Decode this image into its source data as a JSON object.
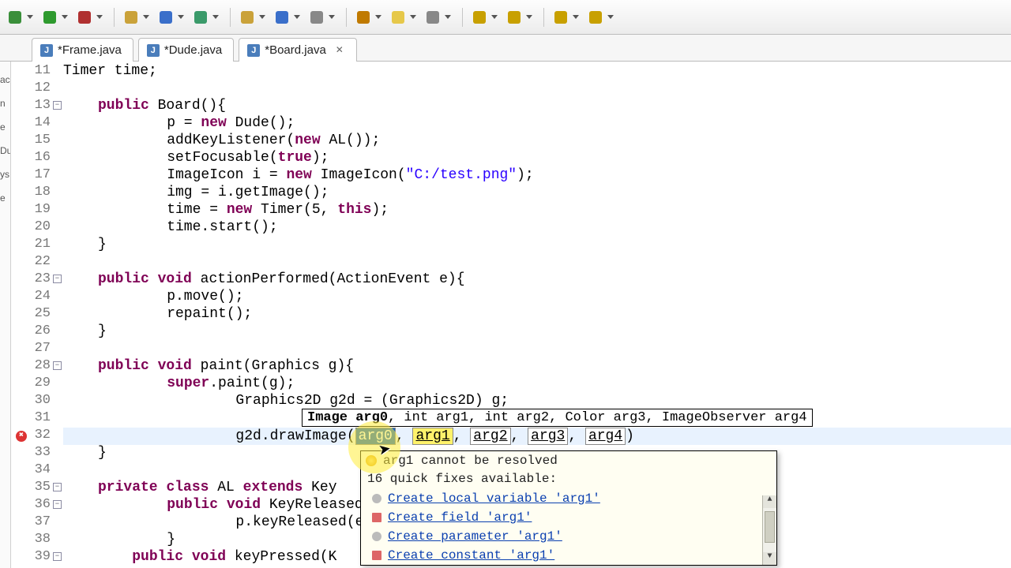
{
  "tabs": [
    {
      "label": "*Frame.java"
    },
    {
      "label": "*Dude.java"
    },
    {
      "label": "*Board.java",
      "active": true,
      "closable": true
    }
  ],
  "left_strip": [
    "ac",
    "n",
    "e",
    "Du",
    "ys",
    "e"
  ],
  "lines": [
    {
      "n": 11,
      "html": "Timer time;"
    },
    {
      "n": 12,
      "html": ""
    },
    {
      "n": 13,
      "html": "<span class='kw'>public</span> Board(){",
      "fold": true
    },
    {
      "n": 14,
      "html": "    p = <span class='kw'>new</span> Dude();"
    },
    {
      "n": 15,
      "html": "    addKeyListener(<span class='kw'>new</span> AL());"
    },
    {
      "n": 16,
      "html": "    setFocusable(<span class='kw'>true</span>);"
    },
    {
      "n": 17,
      "html": "    ImageIcon i = <span class='kw'>new</span> ImageIcon(<span class='str'>\"C:/test.png\"</span>);"
    },
    {
      "n": 18,
      "html": "    img = i.getImage();"
    },
    {
      "n": 19,
      "html": "    time = <span class='kw'>new</span> Timer(5, <span class='kw'>this</span>);"
    },
    {
      "n": 20,
      "html": "    time.start();"
    },
    {
      "n": 21,
      "html": "}"
    },
    {
      "n": 22,
      "html": ""
    },
    {
      "n": 23,
      "html": "<span class='kw'>public</span> <span class='kw'>void</span> actionPerformed(ActionEvent e){",
      "fold": true
    },
    {
      "n": 24,
      "html": "    p.move();"
    },
    {
      "n": 25,
      "html": "    repaint();"
    },
    {
      "n": 26,
      "html": "}"
    },
    {
      "n": 27,
      "html": ""
    },
    {
      "n": 28,
      "html": "<span class='kw'>public</span> <span class='kw'>void</span> paint(Graphics g){",
      "fold": true
    },
    {
      "n": 29,
      "html": "    <span class='kw'>super</span>.paint(g);"
    },
    {
      "n": 30,
      "html": "        Graphics2D g2d = (Graphics2D) g;"
    },
    {
      "n": 31,
      "html": ""
    },
    {
      "n": 32,
      "html": "        g2d.drawImage(<span class='arg-box arg-sel'>arg0</span>, <span class='arg-box arg-warn'>arg1</span>, <span class='arg-box'>arg2</span>, <span class='arg-box'>arg3</span>, <span class='arg-box'>arg4</span>)",
      "err": true,
      "hl": true
    },
    {
      "n": 33,
      "html": "}"
    },
    {
      "n": 34,
      "html": ""
    },
    {
      "n": 35,
      "html": "<span class='kw'>private</span> <span class='kw'>class</span> AL <span class='kw'>extends</span> Key",
      "fold": true
    },
    {
      "n": 36,
      "html": "    <span class='kw'>public</span> <span class='kw'>void</span> KeyReleased(",
      "fold": true
    },
    {
      "n": 37,
      "html": "        p.keyReleased(e);"
    },
    {
      "n": 38,
      "html": "    }"
    },
    {
      "n": 39,
      "html": "    <span class='kw'>public</span> <span class='kw'>void</span> keyPressed(K",
      "fold": true
    }
  ],
  "param_hint": {
    "bold": "Image arg0",
    "rest": ", int arg1, int arg2, Color arg3, ImageObserver arg4"
  },
  "quickfix": {
    "error": "arg1 cannot be resolved",
    "subtitle": "16 quick fixes available:",
    "items": [
      {
        "icon": "round",
        "label": "Create local variable 'arg1'"
      },
      {
        "icon": "sq",
        "label": "Create field 'arg1'"
      },
      {
        "icon": "round",
        "label": "Create parameter 'arg1'"
      },
      {
        "icon": "sq",
        "label": "Create constant 'arg1'"
      }
    ]
  },
  "toolbar_icons": [
    "debug-icon",
    "run-icon",
    "ext-tools-icon",
    "sep",
    "open-type-icon",
    "search-icon",
    "refresh-icon",
    "sep",
    "open-folder-icon",
    "save-icon",
    "print-icon",
    "sep",
    "toggle-mark-icon",
    "toggle-highlight-icon",
    "show-whitespace-icon",
    "sep",
    "next-annotation-icon",
    "prev-annotation-icon",
    "sep",
    "back-icon",
    "forward-icon"
  ]
}
